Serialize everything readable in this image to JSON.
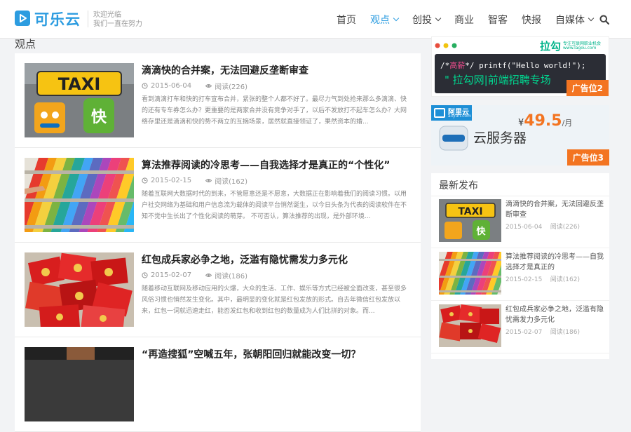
{
  "header": {
    "logo_text": "可乐云",
    "slogan_line1": "欢迎光临",
    "slogan_line2": "我们一直在努力",
    "nav": [
      {
        "label": "首页",
        "active": false,
        "dropdown": false
      },
      {
        "label": "观点",
        "active": true,
        "dropdown": true
      },
      {
        "label": "创投",
        "active": false,
        "dropdown": true
      },
      {
        "label": "商业",
        "active": false,
        "dropdown": false
      },
      {
        "label": "智客",
        "active": false,
        "dropdown": false
      },
      {
        "label": "快报",
        "active": false,
        "dropdown": false
      },
      {
        "label": "自媒体",
        "active": false,
        "dropdown": true
      }
    ],
    "accent_color": "#2c9ce0"
  },
  "section_title": "观点",
  "articles": [
    {
      "title": "滴滴快的合并案，无法回避反垄断审查",
      "date": "2015-06-04",
      "views": "阅读(226)",
      "summary": "看到滴滴打车和快的打车宣布合并，紧张的整个人都不好了。最尽力气到处抢来那么多滴滴、快的还有专车券怎么办？更重要的是两家合并没有竞争对手了，以后不发放打不起车怎么办？大网络存里还是滴滴和快的势不两立的互摘场景，居然就直接领证了，果然资本的婚..."
    },
    {
      "title": "算法推荐阅读的冷思考——自我选择才是真正的“个性化”",
      "date": "2015-02-15",
      "views": "阅读(162)",
      "summary": "随着互联网大数据时代的到来，不管愿意还是不愿意，大数据正在影响着我们的阅读习惯。以用户社交网络为基础和用户信息流为载体的阅读平台悄然诞生，以今日头条为代表的阅读软件在不知不觉中生长出了个性化阅读的萌芽。 不可否认，算法推荐的出现，是外部环境..."
    },
    {
      "title": "红包成兵家必争之地，泛滥有隐忧需发力多元化",
      "date": "2015-02-07",
      "views": "阅读(186)",
      "summary": "随着移动互联网及移动应用的火爆，大众的生活、工作、娱乐等方式已经被全面改变，甚至很多风俗习惯也悄然发生变化。其中，最明显的变化就是红包发放的形式。自去年微信红包发放以来，红包一词就迅速走红，能否发红包和收到红包的数量成为人们比拼的对象。而..."
    },
    {
      "title": "“再造搜狐”空喊五年，张朝阳回归就能改变一切？",
      "date": "",
      "views": "",
      "summary": ""
    }
  ],
  "ads": {
    "lagou": {
      "brand": "拉勾",
      "brand_sub": "专注互联网职业机会",
      "brand_url": "www.lagou.com",
      "code_prefix": "/*",
      "code_highlight": "高薪",
      "code_rest": "*/ printf(\"Hello world!\");",
      "headline": "\" 拉勾网|前端招聘专场",
      "badge": "广告位2"
    },
    "aliyun": {
      "brand": "阿里云",
      "brand_url": "aliyun.com",
      "product": "云服务器",
      "currency": "¥",
      "price": "49.5",
      "unit": "/月",
      "badge": "广告位3"
    }
  },
  "latest": {
    "title": "最新发布",
    "items": [
      {
        "title": "滴滴快的合并案，无法回避反垄断审查",
        "date": "2015-06-04",
        "views": "阅读(226)"
      },
      {
        "title": "算法推荐阅读的冷思考——自我选择才是真正的",
        "date": "2015-02-15",
        "views": "阅读(162)"
      },
      {
        "title": "红包成兵家必争之地，泛滥有隐忧需发力多元化",
        "date": "2015-02-07",
        "views": "阅读(186)"
      }
    ]
  },
  "thumb_text": {
    "taxi": "TAXI",
    "kuai": "快"
  }
}
